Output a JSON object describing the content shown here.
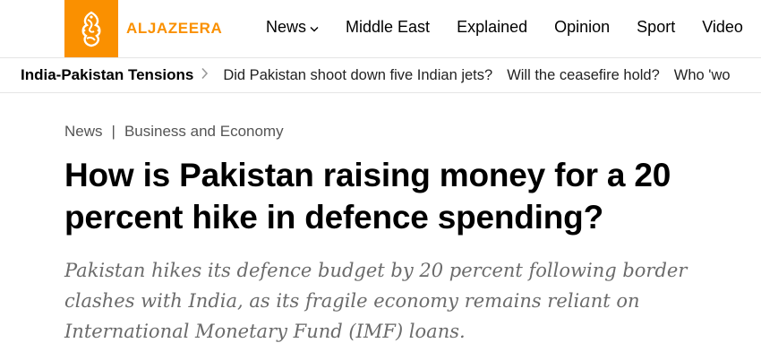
{
  "brand": {
    "name": "ALJAZEERA",
    "accent_color": "#fa9000"
  },
  "nav": {
    "items": [
      {
        "label": "News",
        "has_dropdown": true
      },
      {
        "label": "Middle East"
      },
      {
        "label": "Explained"
      },
      {
        "label": "Opinion"
      },
      {
        "label": "Sport"
      },
      {
        "label": "Video"
      }
    ]
  },
  "trending": {
    "title": "India-Pakistan Tensions",
    "links": [
      "Did Pakistan shoot down five Indian jets?",
      "Will the ceasefire hold?",
      "Who 'wo"
    ]
  },
  "article": {
    "breadcrumb": [
      "News",
      "Business and Economy"
    ],
    "breadcrumb_separator": "|",
    "headline": "How is Pakistan raising money for a 20 percent hike in defence spending?",
    "summary": "Pakistan hikes its defence budget by 20 percent following border clashes with India, as its fragile economy remains reliant on International Monetary Fund (IMF) loans."
  }
}
